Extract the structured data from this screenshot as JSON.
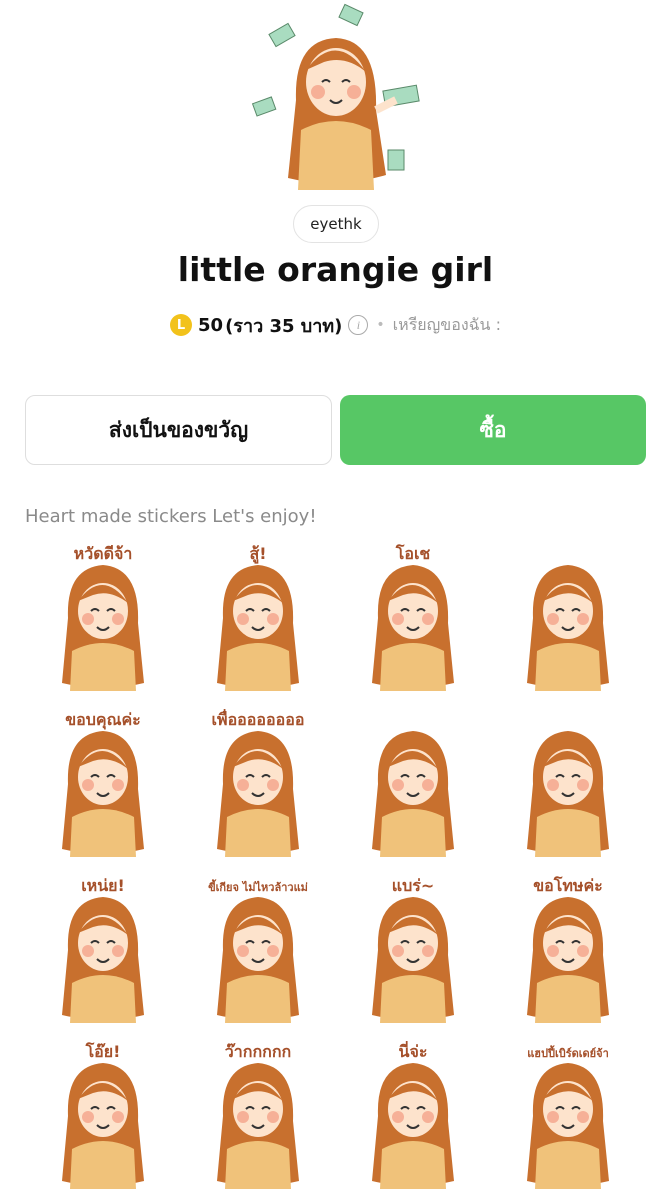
{
  "creator": "eyethk",
  "title": "little orangie girl",
  "price": {
    "coin_symbol": "L",
    "coins": "50",
    "approx": "(ราว 35 บาท)",
    "my_coins_label": "เหรียญของฉัน :"
  },
  "buttons": {
    "gift": "ส่งเป็นของขวัญ",
    "buy": "ซื้อ"
  },
  "description": "Heart made stickers Let's enjoy!",
  "colors": {
    "buy_green": "#57c765",
    "coin_gold": "#f2c21b",
    "hair": "#c8702e",
    "shirt": "#f0c27a",
    "text_brown": "#a5502a"
  },
  "stickers": [
    {
      "caption": "หวัดดีจ้า",
      "icon": "girl-waving"
    },
    {
      "caption": "สู้!",
      "icon": "girl-fighting"
    },
    {
      "caption": "โอเช",
      "icon": "girl-ok-sign"
    },
    {
      "caption": "",
      "icon": "girl-with-money"
    },
    {
      "caption": "ขอบคุณค่ะ",
      "icon": "girl-thank-you"
    },
    {
      "caption": "เพื่ออออออออ",
      "icon": "girl-what"
    },
    {
      "caption": "",
      "icon": "girl-fainted-ghost"
    },
    {
      "caption": "",
      "icon": "girl-melting"
    },
    {
      "caption": "เหน่ย!",
      "icon": "girl-tired-sitting"
    },
    {
      "caption": "ขี้เกียจ ไม่ไหวล้าวแม่",
      "icon": "girl-lazy-lying"
    },
    {
      "caption": "แบร่~",
      "icon": "girl-tongue-out"
    },
    {
      "caption": "ขอโทษค่ะ",
      "icon": "girl-sorry"
    },
    {
      "caption": "โอ๊ย!",
      "icon": "girl-headache"
    },
    {
      "caption": "ว๊ากกกกก",
      "icon": "girl-screaming"
    },
    {
      "caption": "นี่จ่ะ",
      "icon": "girl-giving"
    },
    {
      "caption": "แฮปปี้เบิร์ดเดย์จ้า",
      "icon": "girl-birthday-cake"
    }
  ]
}
